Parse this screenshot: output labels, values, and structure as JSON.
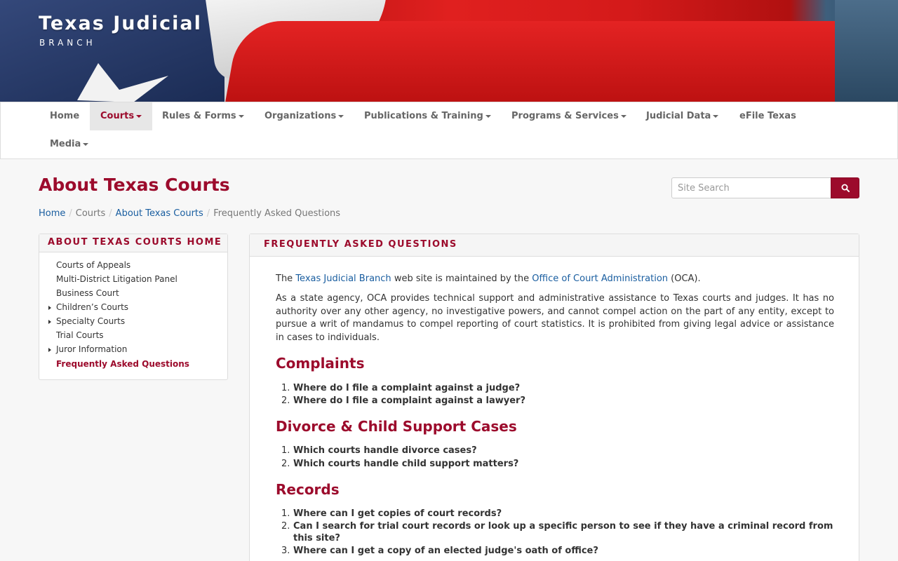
{
  "brand": {
    "title": "Texas Judicial",
    "subtitle": "BRANCH"
  },
  "nav": {
    "items": [
      {
        "label": "Home",
        "dropdown": false
      },
      {
        "label": "Courts",
        "dropdown": true,
        "active": true
      },
      {
        "label": "Rules & Forms",
        "dropdown": true
      },
      {
        "label": "Organizations",
        "dropdown": true
      },
      {
        "label": "Publications & Training",
        "dropdown": true
      },
      {
        "label": "Programs & Services",
        "dropdown": true
      },
      {
        "label": "Judicial Data",
        "dropdown": true
      },
      {
        "label": "eFile Texas",
        "dropdown": false
      },
      {
        "label": "Media",
        "dropdown": true
      }
    ]
  },
  "page": {
    "title": "About Texas Courts"
  },
  "search": {
    "placeholder": "Site Search",
    "icon": "search-icon"
  },
  "breadcrumb": [
    "Home",
    "Courts",
    "About Texas Courts",
    "Frequently Asked Questions"
  ],
  "sidebar": {
    "heading": "ABOUT TEXAS COURTS HOME",
    "items": [
      {
        "label": "Courts of Appeals",
        "expandable": false
      },
      {
        "label": "Multi-District Litigation Panel",
        "expandable": false
      },
      {
        "label": "Business Court",
        "expandable": false
      },
      {
        "label": "Children’s Courts",
        "expandable": true
      },
      {
        "label": "Specialty Courts",
        "expandable": true
      },
      {
        "label": "Trial Courts",
        "expandable": false
      },
      {
        "label": "Juror Information",
        "expandable": true
      },
      {
        "label": "Frequently Asked Questions",
        "expandable": false,
        "current": true
      }
    ]
  },
  "panel": {
    "heading": "FREQUENTLY ASKED QUESTIONS",
    "intro": {
      "the": "The",
      "link1": "Texas Judicial Branch",
      "mid": "web site is maintained by the",
      "link2": "Office of Court Administration",
      "end": "(OCA)."
    },
    "paragraph": "As a state agency, OCA provides technical support and administrative assistance to Texas courts and judges. It has no authority over any other agency, no investigative powers, and cannot compel action on the part of any entity, except to pursue a writ of mandamus to compel reporting of court statistics. It is prohibited from giving legal advice or assistance in cases to individuals.",
    "sections": [
      {
        "title": "Complaints",
        "questions": [
          "Where do I file a complaint against a judge?",
          "Where do I file a complaint against a lawyer?"
        ]
      },
      {
        "title": "Divorce & Child Support Cases",
        "questions": [
          "Which courts handle divorce cases?",
          "Which courts handle child support matters?"
        ]
      },
      {
        "title": "Records",
        "questions": [
          "Where can I get copies of court records?",
          "Can I search for trial court records or look up a specific person to see if they have a criminal record from this site?",
          "Where can I get a copy of an elected judge's oath of office?"
        ]
      }
    ]
  },
  "colors": {
    "accent": "#9c0b2c",
    "link": "#1a5ea0"
  }
}
